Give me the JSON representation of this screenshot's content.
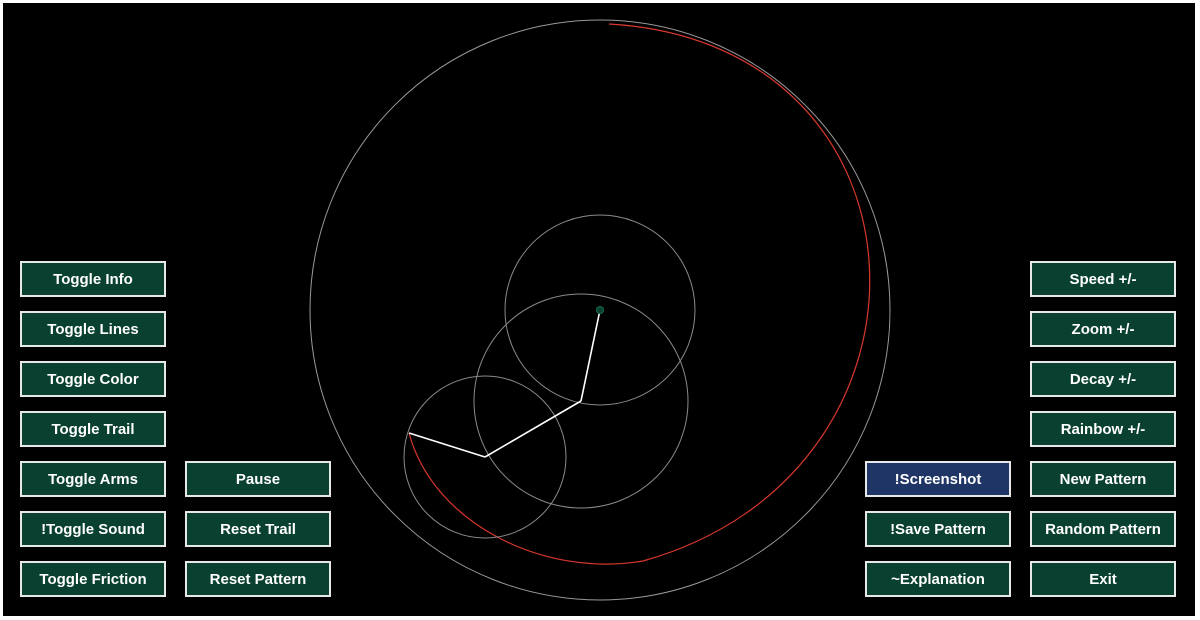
{
  "colors": {
    "background": "#000000",
    "button_fill": "#0a4030",
    "button_highlight_fill": "#1f3566",
    "button_border": "#e8e8e8",
    "circle_stroke": "#9a9a9a",
    "arm_stroke": "#ffffff",
    "trail_stroke": "#d9382e",
    "pivot_fill": "#0a4030"
  },
  "left_buttons": [
    {
      "label": "Toggle Info",
      "name": "toggle-info-button"
    },
    {
      "label": "Toggle Lines",
      "name": "toggle-lines-button"
    },
    {
      "label": "Toggle Color",
      "name": "toggle-color-button"
    },
    {
      "label": "Toggle Trail",
      "name": "toggle-trail-button"
    },
    {
      "label": "Toggle Arms",
      "name": "toggle-arms-button"
    },
    {
      "label": "!Toggle Sound",
      "name": "toggle-sound-button"
    },
    {
      "label": "Toggle Friction",
      "name": "toggle-friction-button"
    }
  ],
  "center_left_buttons": [
    {
      "label": "Pause",
      "name": "pause-button"
    },
    {
      "label": "Reset Trail",
      "name": "reset-trail-button"
    },
    {
      "label": "Reset Pattern",
      "name": "reset-pattern-button"
    }
  ],
  "center_right_buttons": [
    {
      "label": "!Screenshot",
      "name": "screenshot-button",
      "highlight": true
    },
    {
      "label": "!Save Pattern",
      "name": "save-pattern-button"
    },
    {
      "label": "~Explanation",
      "name": "explanation-button"
    }
  ],
  "right_buttons": [
    {
      "label": "Speed +/-",
      "name": "speed-button"
    },
    {
      "label": "Zoom +/-",
      "name": "zoom-button"
    },
    {
      "label": "Decay +/-",
      "name": "decay-button"
    },
    {
      "label": "Rainbow +/-",
      "name": "rainbow-button"
    },
    {
      "label": "New Pattern",
      "name": "new-pattern-button"
    },
    {
      "label": "Random Pattern",
      "name": "random-pattern-button"
    },
    {
      "label": "Exit",
      "name": "exit-button"
    }
  ]
}
